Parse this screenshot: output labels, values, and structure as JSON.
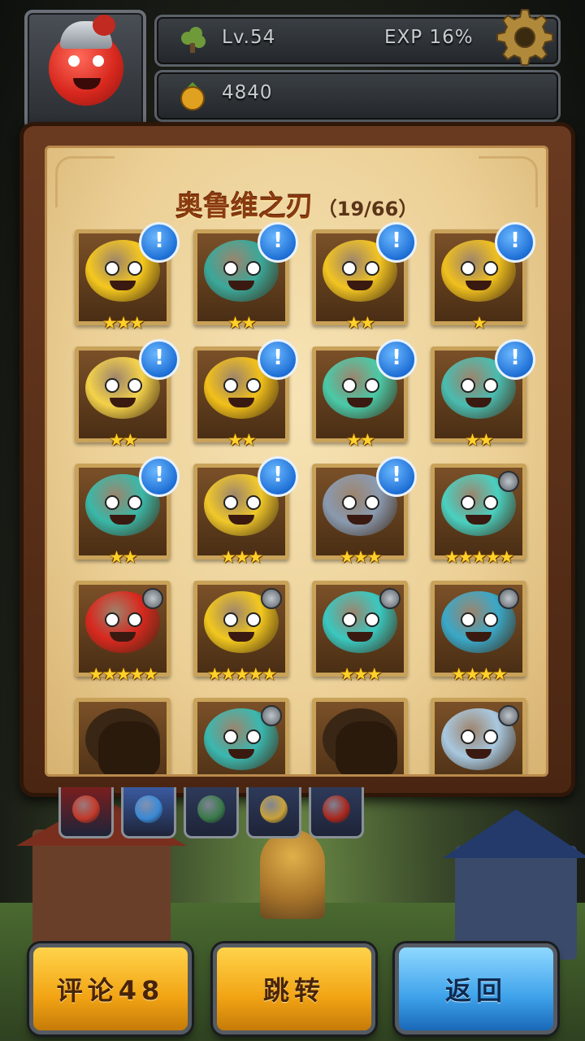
{
  "hud": {
    "level": "Lv.54",
    "exp": "EXP 16%",
    "coins": "4840"
  },
  "panel": {
    "title": "奥鲁维之刃",
    "count": "（19/66）"
  },
  "heroes": [
    {
      "stars": "★★★",
      "alert": "!",
      "color": "#f5c81e"
    },
    {
      "stars": "★★",
      "alert": "!",
      "color": "#3aa89a"
    },
    {
      "stars": "★★",
      "alert": "!",
      "color": "#f2c422"
    },
    {
      "stars": "★",
      "alert": "!",
      "color": "#f0c01e"
    },
    {
      "stars": "★★",
      "alert": "!",
      "color": "#f4d24a"
    },
    {
      "stars": "★★",
      "alert": "!",
      "color": "#f2c01a"
    },
    {
      "stars": "★★",
      "alert": "!",
      "color": "#4acaa8"
    },
    {
      "stars": "★★",
      "alert": "!",
      "color": "#4abcb0"
    },
    {
      "stars": "★★",
      "alert": "!",
      "color": "#3ab8a8"
    },
    {
      "stars": "★★★",
      "alert": "!",
      "color": "#f0c82a"
    },
    {
      "stars": "★★★",
      "alert": "!",
      "color": "#8a9ab0"
    },
    {
      "stars": "★★★★★",
      "alert": "",
      "color": "#4ad0c0"
    },
    {
      "stars": "★★★★★",
      "alert": "",
      "color": "#d8281e"
    },
    {
      "stars": "★★★★★",
      "alert": "",
      "color": "#f2c81e"
    },
    {
      "stars": "★★★",
      "alert": "",
      "color": "#3ac8c0"
    },
    {
      "stars": "★★★★",
      "alert": "",
      "color": "#3aa8c8"
    },
    {
      "stars": "",
      "alert": "",
      "color": "#3a2614",
      "locked": true
    },
    {
      "stars": "",
      "alert": "",
      "color": "#3ab8b0"
    },
    {
      "stars": "",
      "alert": "",
      "color": "#3a2614",
      "locked": true
    },
    {
      "stars": "",
      "alert": "",
      "color": "#a8c8e0"
    }
  ],
  "tabs": [
    {
      "icon": "red-hero-tab-icon",
      "color": "#c23a2a",
      "bg": "#7a1e1e"
    },
    {
      "icon": "blue-hero-tab-icon",
      "color": "#3a8ad6",
      "bg": "#3a5aa0"
    },
    {
      "icon": "green-hero-tab-icon",
      "color": "#3a7a4a",
      "bg": "#2e3a5a"
    },
    {
      "icon": "yellow-hero-tab-icon",
      "color": "#c8a23a",
      "bg": "#2e3a5a"
    },
    {
      "icon": "red-mask-tab-icon",
      "color": "#a8281e",
      "bg": "#2e3a5a"
    }
  ],
  "buttons": {
    "comment": "评论48",
    "jump": "跳转",
    "back": "返回"
  },
  "colors": {
    "title": "#8a3a10",
    "star": "#ffd12a",
    "alert_blue": "#1e6fd6",
    "button_yellow": "#f2a414",
    "button_blue": "#3ea2ea"
  }
}
